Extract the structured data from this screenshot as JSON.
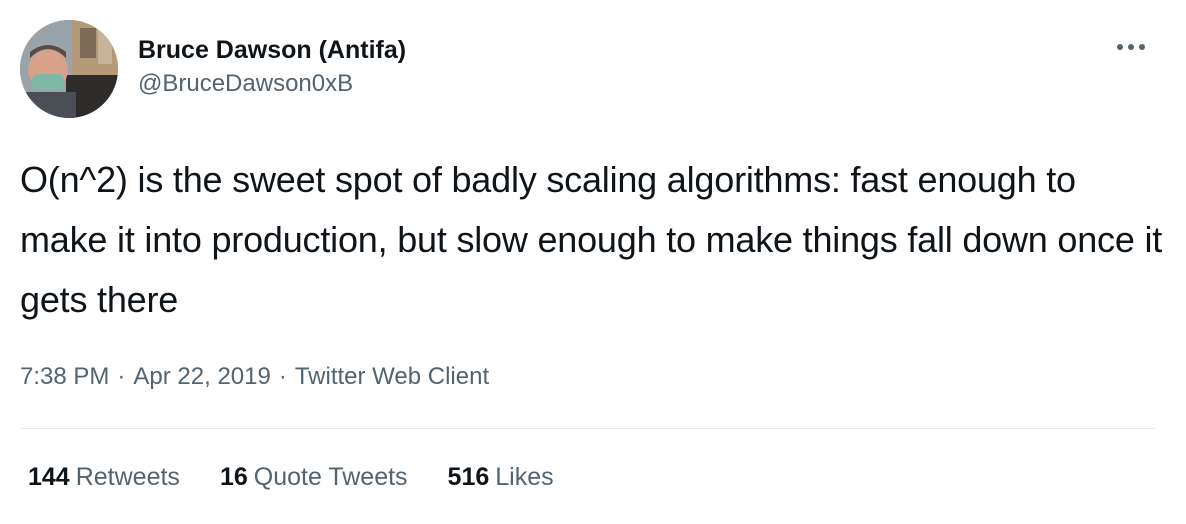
{
  "author": {
    "display_name": "Bruce Dawson (Antifa)",
    "handle": "@BruceDawson0xB",
    "avatar_icon": "profile-photo"
  },
  "more_icon": "more-horizontal-icon",
  "tweet": {
    "text": "O(n^2) is the sweet spot of badly scaling algorithms: fast enough to make it into production, but slow enough to make things fall down once it gets there"
  },
  "meta": {
    "time": "7:38 PM",
    "date": "Apr 22, 2019",
    "client": "Twitter Web Client",
    "separator": "·"
  },
  "stats": {
    "retweets": {
      "count": "144",
      "label": "Retweets"
    },
    "quotes": {
      "count": "16",
      "label": "Quote Tweets"
    },
    "likes": {
      "count": "516",
      "label": "Likes"
    }
  },
  "colors": {
    "text_primary": "#0f1419",
    "text_secondary": "#536471",
    "divider": "#e6ecf0"
  }
}
